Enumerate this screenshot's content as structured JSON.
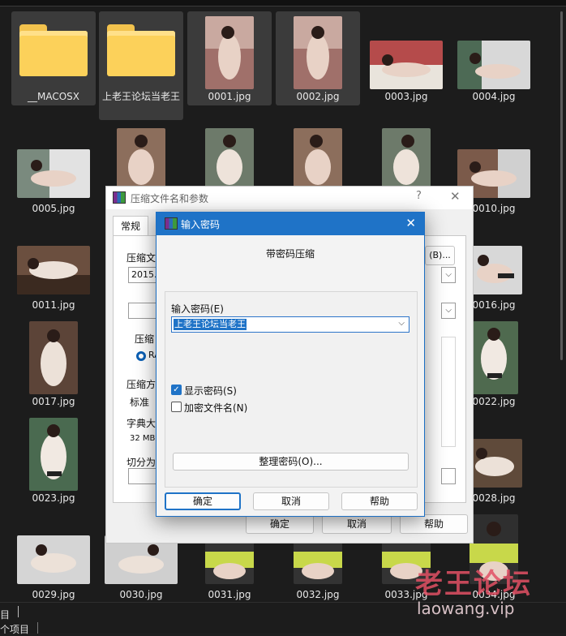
{
  "explorer": {
    "items": [
      {
        "name": "__MACOSX",
        "kind": "folder"
      },
      {
        "name": "上老王论坛当老王",
        "kind": "folder"
      },
      {
        "name": "0001.jpg",
        "kind": "image"
      },
      {
        "name": "0002.jpg",
        "kind": "image"
      },
      {
        "name": "0003.jpg",
        "kind": "image"
      },
      {
        "name": "0004.jpg",
        "kind": "image"
      },
      {
        "name": "0005.jpg",
        "kind": "image"
      },
      {
        "name": "0010.jpg",
        "kind": "image"
      },
      {
        "name": "0011.jpg",
        "kind": "image"
      },
      {
        "name": "0016.jpg",
        "kind": "image"
      },
      {
        "name": "0017.jpg",
        "kind": "image"
      },
      {
        "name": "0022.jpg",
        "kind": "image"
      },
      {
        "name": "0023.jpg",
        "kind": "image"
      },
      {
        "name": "0028.jpg",
        "kind": "image"
      },
      {
        "name": "0029.jpg",
        "kind": "image"
      },
      {
        "name": "0030.jpg",
        "kind": "image"
      },
      {
        "name": "0031.jpg",
        "kind": "image"
      },
      {
        "name": "0032.jpg",
        "kind": "image"
      },
      {
        "name": "0033.jpg",
        "kind": "image"
      },
      {
        "name": "0034.jpg",
        "kind": "image"
      }
    ]
  },
  "statusbar": {
    "left": "目",
    "second": "个项目"
  },
  "archive_dialog": {
    "title": "压缩文件名和参数",
    "help": "?",
    "close": "✕",
    "tab_general": "常规",
    "archive_name_label": "压缩文",
    "archive_name_value": "2015.0",
    "browse_button": "(B)...",
    "format_label": "压缩",
    "format_radio": "RA",
    "method_label": "压缩方",
    "method_value": "标准",
    "dict_label": "字典大",
    "dict_value": "32 MB",
    "split_label": "切分为",
    "ok": "确定",
    "cancel": "取消",
    "help_button": "帮助"
  },
  "password_dialog": {
    "title": "输入密码",
    "close": "✕",
    "heading": "带密码压缩",
    "input_label": "输入密码(E)",
    "input_value": "上老王论坛当老王",
    "show_password": {
      "label": "显示密码(S)",
      "checked": true
    },
    "encrypt_names": {
      "label": "加密文件名(N)",
      "checked": false
    },
    "organize_button": "整理密码(O)...",
    "ok": "确定",
    "cancel": "取消",
    "help": "帮助"
  },
  "watermark": {
    "cn": "老王论坛",
    "en": "laowang.vip"
  },
  "colors": {
    "accent": "#1f73c7",
    "folder": "#fcd15a",
    "background": "#1c1c1c"
  }
}
